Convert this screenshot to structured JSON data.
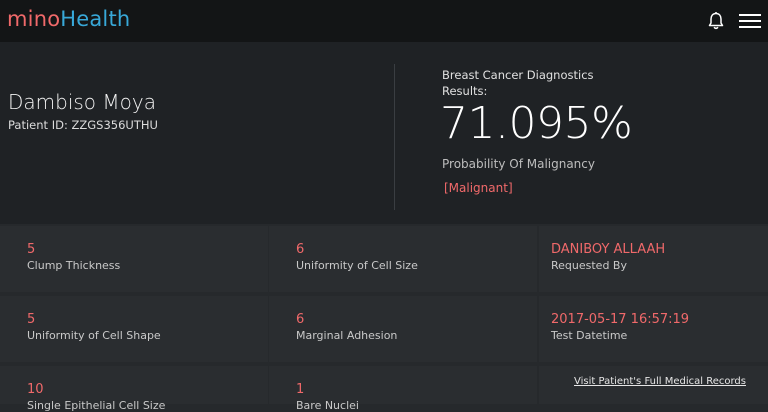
{
  "app": {
    "logo_part1": "mino",
    "logo_part2": "Health"
  },
  "header_icons": {
    "notifications": "bell-icon",
    "menu": "hamburger-menu-icon"
  },
  "patient": {
    "name": "Dambiso Moya",
    "id_label": "Patient ID:",
    "id_value": "ZZGS356UTHU"
  },
  "diagnostics": {
    "title": "Breast Cancer Diagnostics",
    "results_label": "Results:",
    "probability_value": "71.095%",
    "probability_label": "Probability Of Malignancy",
    "classification": "[Malignant]"
  },
  "features": [
    {
      "value": "5",
      "label": "Clump Thickness"
    },
    {
      "value": "6",
      "label": "Uniformity of Cell Size"
    },
    {
      "value": "5",
      "label": "Uniformity of Cell Shape"
    },
    {
      "value": "6",
      "label": "Marginal Adhesion"
    },
    {
      "value": "10",
      "label": "Single Epithelial Cell Size"
    },
    {
      "value": "1",
      "label": "Bare Nuclei"
    }
  ],
  "meta": {
    "requested_by_value": "DANIBOY ALLAAH",
    "requested_by_label": "Requested By",
    "test_datetime_value": "2017-05-17 16:57:19",
    "test_datetime_label": "Test Datetime",
    "records_link": "Visit Patient's Full Medical Records"
  },
  "colors": {
    "accent_red": "#f0696a",
    "accent_blue": "#38a8d8",
    "topbar_bg": "#131516",
    "hero_bg": "#1f2225",
    "cell_bg": "#2a2d30"
  }
}
